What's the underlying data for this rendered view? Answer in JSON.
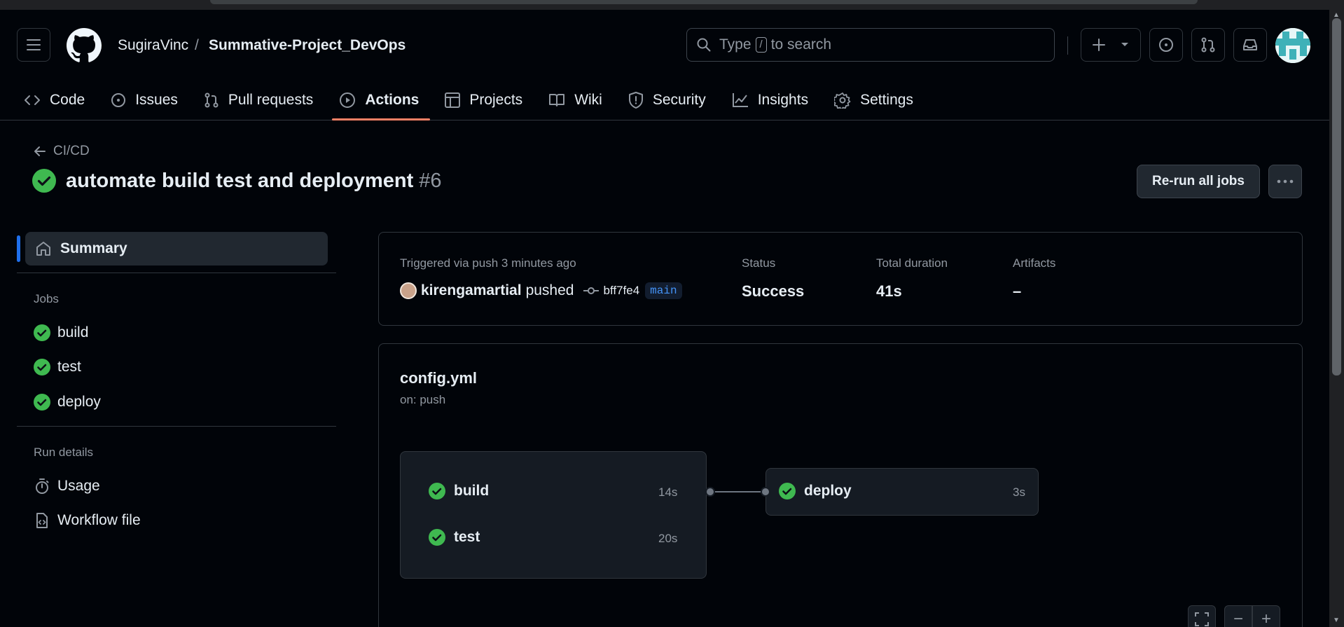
{
  "header": {
    "owner": "SugiraVinc",
    "separator": "/",
    "repo": "Summative-Project_DevOps",
    "search": {
      "prefix": "Type",
      "key": "/",
      "suffix": "to search"
    }
  },
  "tabs": [
    {
      "label": "Code",
      "icon": "code-icon"
    },
    {
      "label": "Issues",
      "icon": "issue-opened-icon"
    },
    {
      "label": "Pull requests",
      "icon": "git-pull-request-icon"
    },
    {
      "label": "Actions",
      "icon": "play-icon",
      "active": true
    },
    {
      "label": "Projects",
      "icon": "table-icon"
    },
    {
      "label": "Wiki",
      "icon": "book-icon"
    },
    {
      "label": "Security",
      "icon": "shield-icon"
    },
    {
      "label": "Insights",
      "icon": "graph-icon"
    },
    {
      "label": "Settings",
      "icon": "gear-icon"
    }
  ],
  "run": {
    "back_label": "CI/CD",
    "title": "automate build test and deployment",
    "number": "#6",
    "rerun_label": "Re-run all jobs"
  },
  "sidebar": {
    "summary": "Summary",
    "jobs_heading": "Jobs",
    "jobs": [
      "build",
      "test",
      "deploy"
    ],
    "run_details_heading": "Run details",
    "usage": "Usage",
    "workflow_file": "Workflow file"
  },
  "summary": {
    "triggered": "Triggered via push 3 minutes ago",
    "user": "kirengamartial",
    "action": "pushed",
    "commit": "bff7fe4",
    "branch": "main",
    "status_label": "Status",
    "status_value": "Success",
    "duration_label": "Total duration",
    "duration_value": "41s",
    "artifacts_label": "Artifacts",
    "artifacts_value": "–"
  },
  "graph": {
    "file": "config.yml",
    "trigger": "on: push",
    "jobs": [
      {
        "name": "build",
        "duration": "14s"
      },
      {
        "name": "test",
        "duration": "20s"
      },
      {
        "name": "deploy",
        "duration": "3s"
      }
    ],
    "zoom_minus": "−",
    "zoom_plus": "+"
  },
  "colors": {
    "success": "#3fb950",
    "active_tab_underline": "#f78166",
    "accent": "#1f6feb",
    "branch_text": "#4493f8"
  }
}
